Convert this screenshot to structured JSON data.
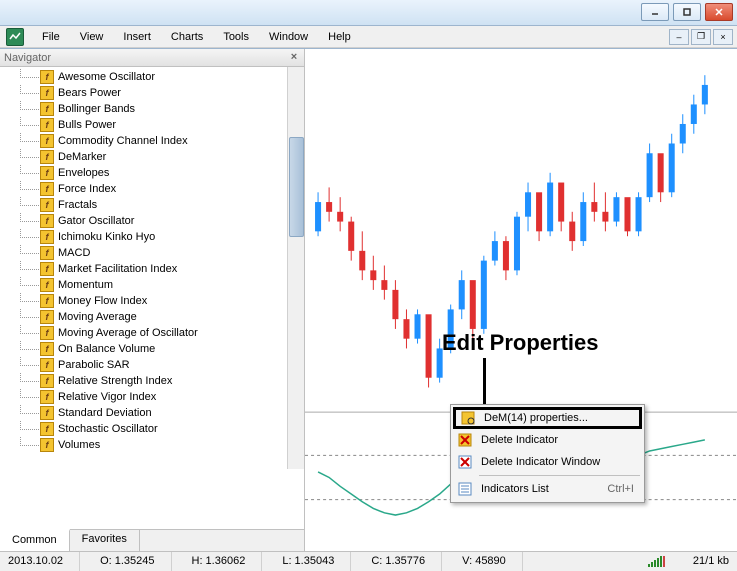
{
  "menubar": {
    "items": [
      "File",
      "View",
      "Insert",
      "Charts",
      "Tools",
      "Window",
      "Help"
    ]
  },
  "navigator": {
    "title": "Navigator",
    "items": [
      "Awesome Oscillator",
      "Bears Power",
      "Bollinger Bands",
      "Bulls Power",
      "Commodity Channel Index",
      "DeMarker",
      "Envelopes",
      "Force Index",
      "Fractals",
      "Gator Oscillator",
      "Ichimoku Kinko Hyo",
      "MACD",
      "Market Facilitation Index",
      "Momentum",
      "Money Flow Index",
      "Moving Average",
      "Moving Average of Oscillator",
      "On Balance Volume",
      "Parabolic SAR",
      "Relative Strength Index",
      "Relative Vigor Index",
      "Standard Deviation",
      "Stochastic Oscillator",
      "Volumes"
    ],
    "tabs": {
      "common": "Common",
      "favorites": "Favorites"
    }
  },
  "contextmenu": {
    "properties": "DeM(14) properties...",
    "delete_ind": "Delete Indicator",
    "delete_win": "Delete Indicator Window",
    "ind_list": "Indicators List",
    "shortcut": "Ctrl+I"
  },
  "annotation": "Edit Properties",
  "statusbar": {
    "date": "2013.10.02",
    "o": "O: 1.35245",
    "h": "H: 1.36062",
    "l": "L: 1.35043",
    "c": "C: 1.35776",
    "v": "V: 45890",
    "kb": "21/1 kb"
  },
  "chart_data": {
    "type": "candlestick",
    "note": "values are approximate pixel-estimated OHLC",
    "candles": [
      {
        "o": 1.35,
        "h": 1.358,
        "l": 1.349,
        "c": 1.356,
        "dir": "up"
      },
      {
        "o": 1.356,
        "h": 1.359,
        "l": 1.352,
        "c": 1.354,
        "dir": "down"
      },
      {
        "o": 1.354,
        "h": 1.357,
        "l": 1.35,
        "c": 1.352,
        "dir": "down"
      },
      {
        "o": 1.352,
        "h": 1.353,
        "l": 1.344,
        "c": 1.346,
        "dir": "down"
      },
      {
        "o": 1.346,
        "h": 1.35,
        "l": 1.34,
        "c": 1.342,
        "dir": "down"
      },
      {
        "o": 1.342,
        "h": 1.345,
        "l": 1.338,
        "c": 1.34,
        "dir": "down"
      },
      {
        "o": 1.34,
        "h": 1.343,
        "l": 1.336,
        "c": 1.338,
        "dir": "down"
      },
      {
        "o": 1.338,
        "h": 1.34,
        "l": 1.33,
        "c": 1.332,
        "dir": "down"
      },
      {
        "o": 1.332,
        "h": 1.334,
        "l": 1.326,
        "c": 1.328,
        "dir": "down"
      },
      {
        "o": 1.328,
        "h": 1.334,
        "l": 1.327,
        "c": 1.333,
        "dir": "up"
      },
      {
        "o": 1.333,
        "h": 1.33,
        "l": 1.318,
        "c": 1.32,
        "dir": "down"
      },
      {
        "o": 1.32,
        "h": 1.328,
        "l": 1.319,
        "c": 1.326,
        "dir": "up"
      },
      {
        "o": 1.326,
        "h": 1.335,
        "l": 1.325,
        "c": 1.334,
        "dir": "up"
      },
      {
        "o": 1.334,
        "h": 1.342,
        "l": 1.332,
        "c": 1.34,
        "dir": "up"
      },
      {
        "o": 1.34,
        "h": 1.338,
        "l": 1.328,
        "c": 1.33,
        "dir": "down"
      },
      {
        "o": 1.33,
        "h": 1.345,
        "l": 1.329,
        "c": 1.344,
        "dir": "up"
      },
      {
        "o": 1.344,
        "h": 1.35,
        "l": 1.343,
        "c": 1.348,
        "dir": "up"
      },
      {
        "o": 1.348,
        "h": 1.349,
        "l": 1.34,
        "c": 1.342,
        "dir": "down"
      },
      {
        "o": 1.342,
        "h": 1.354,
        "l": 1.341,
        "c": 1.353,
        "dir": "up"
      },
      {
        "o": 1.353,
        "h": 1.36,
        "l": 1.35,
        "c": 1.358,
        "dir": "up"
      },
      {
        "o": 1.358,
        "h": 1.356,
        "l": 1.348,
        "c": 1.35,
        "dir": "down"
      },
      {
        "o": 1.35,
        "h": 1.362,
        "l": 1.349,
        "c": 1.36,
        "dir": "up"
      },
      {
        "o": 1.36,
        "h": 1.358,
        "l": 1.35,
        "c": 1.352,
        "dir": "down"
      },
      {
        "o": 1.352,
        "h": 1.354,
        "l": 1.346,
        "c": 1.348,
        "dir": "down"
      },
      {
        "o": 1.348,
        "h": 1.358,
        "l": 1.347,
        "c": 1.356,
        "dir": "up"
      },
      {
        "o": 1.356,
        "h": 1.36,
        "l": 1.352,
        "c": 1.354,
        "dir": "down"
      },
      {
        "o": 1.354,
        "h": 1.358,
        "l": 1.35,
        "c": 1.352,
        "dir": "down"
      },
      {
        "o": 1.352,
        "h": 1.358,
        "l": 1.351,
        "c": 1.357,
        "dir": "up"
      },
      {
        "o": 1.357,
        "h": 1.356,
        "l": 1.349,
        "c": 1.35,
        "dir": "down"
      },
      {
        "o": 1.35,
        "h": 1.358,
        "l": 1.349,
        "c": 1.357,
        "dir": "up"
      },
      {
        "o": 1.357,
        "h": 1.368,
        "l": 1.356,
        "c": 1.366,
        "dir": "up"
      },
      {
        "o": 1.366,
        "h": 1.364,
        "l": 1.356,
        "c": 1.358,
        "dir": "down"
      },
      {
        "o": 1.358,
        "h": 1.37,
        "l": 1.357,
        "c": 1.368,
        "dir": "up"
      },
      {
        "o": 1.368,
        "h": 1.374,
        "l": 1.366,
        "c": 1.372,
        "dir": "up"
      },
      {
        "o": 1.372,
        "h": 1.378,
        "l": 1.37,
        "c": 1.376,
        "dir": "up"
      },
      {
        "o": 1.376,
        "h": 1.382,
        "l": 1.374,
        "c": 1.38,
        "dir": "up"
      }
    ],
    "indicator": {
      "name": "DeM(14)",
      "y": [
        0.55,
        0.5,
        0.42,
        0.35,
        0.28,
        0.22,
        0.18,
        0.16,
        0.18,
        0.22,
        0.28,
        0.35,
        0.44,
        0.52,
        0.58,
        0.62,
        0.64,
        0.62,
        0.6,
        0.62,
        0.66,
        0.7,
        0.72,
        0.7,
        0.66,
        0.62,
        0.6,
        0.62,
        0.66,
        0.7,
        0.74,
        0.76,
        0.78,
        0.8,
        0.82,
        0.84
      ],
      "levels": [
        0.3,
        0.7
      ]
    }
  }
}
